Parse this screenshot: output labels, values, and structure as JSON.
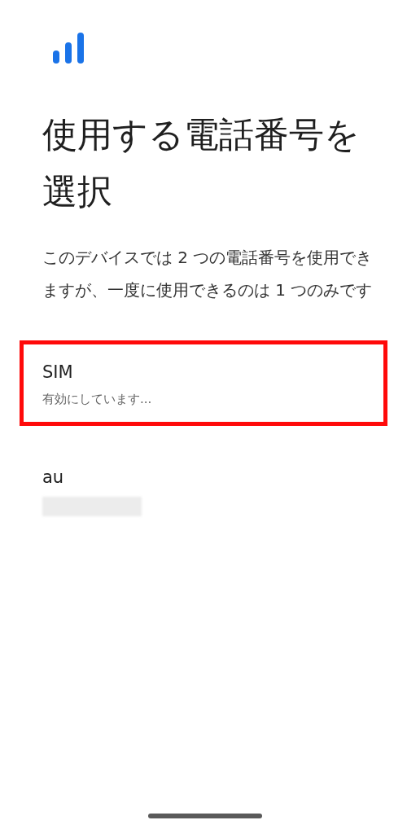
{
  "title": "使用する電話番号を選択",
  "description": "このデバイスでは 2 つの電話番号を使用できますが、一度に使用できるのは 1 つのみです",
  "options": [
    {
      "name": "SIM",
      "status": "有効にしています...",
      "highlighted": true,
      "number_redacted": false
    },
    {
      "name": "au",
      "highlighted": false,
      "number_redacted": true
    }
  ]
}
